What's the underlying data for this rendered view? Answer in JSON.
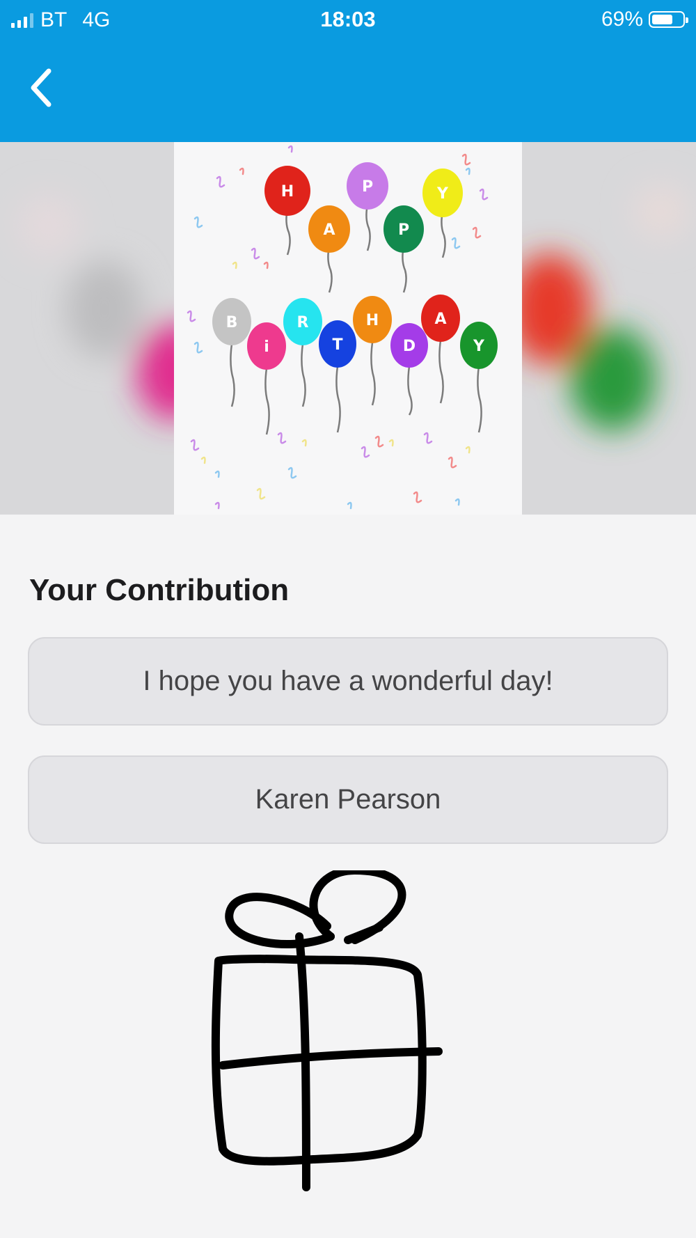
{
  "status_bar": {
    "carrier": "BT",
    "network": "4G",
    "time": "18:03",
    "battery": "69%",
    "battery_level": 0.69
  },
  "nav": {
    "back_icon": "chevron-left-icon"
  },
  "card": {
    "image": "happy-birthday-balloons-card",
    "balloon_letters_row1": [
      "H",
      "A",
      "P",
      "P",
      "Y"
    ],
    "balloon_letters_row2": [
      "B",
      "i",
      "R",
      "T",
      "H",
      "D",
      "A",
      "Y"
    ]
  },
  "contribution": {
    "title": "Your Contribution",
    "message": "I hope you have a wonderful day!",
    "name": "Karen Pearson",
    "drawing": "gift-box-drawing"
  },
  "colors": {
    "header": "#0a9be0",
    "background": "#f4f4f5",
    "field": "#e5e5e8"
  }
}
